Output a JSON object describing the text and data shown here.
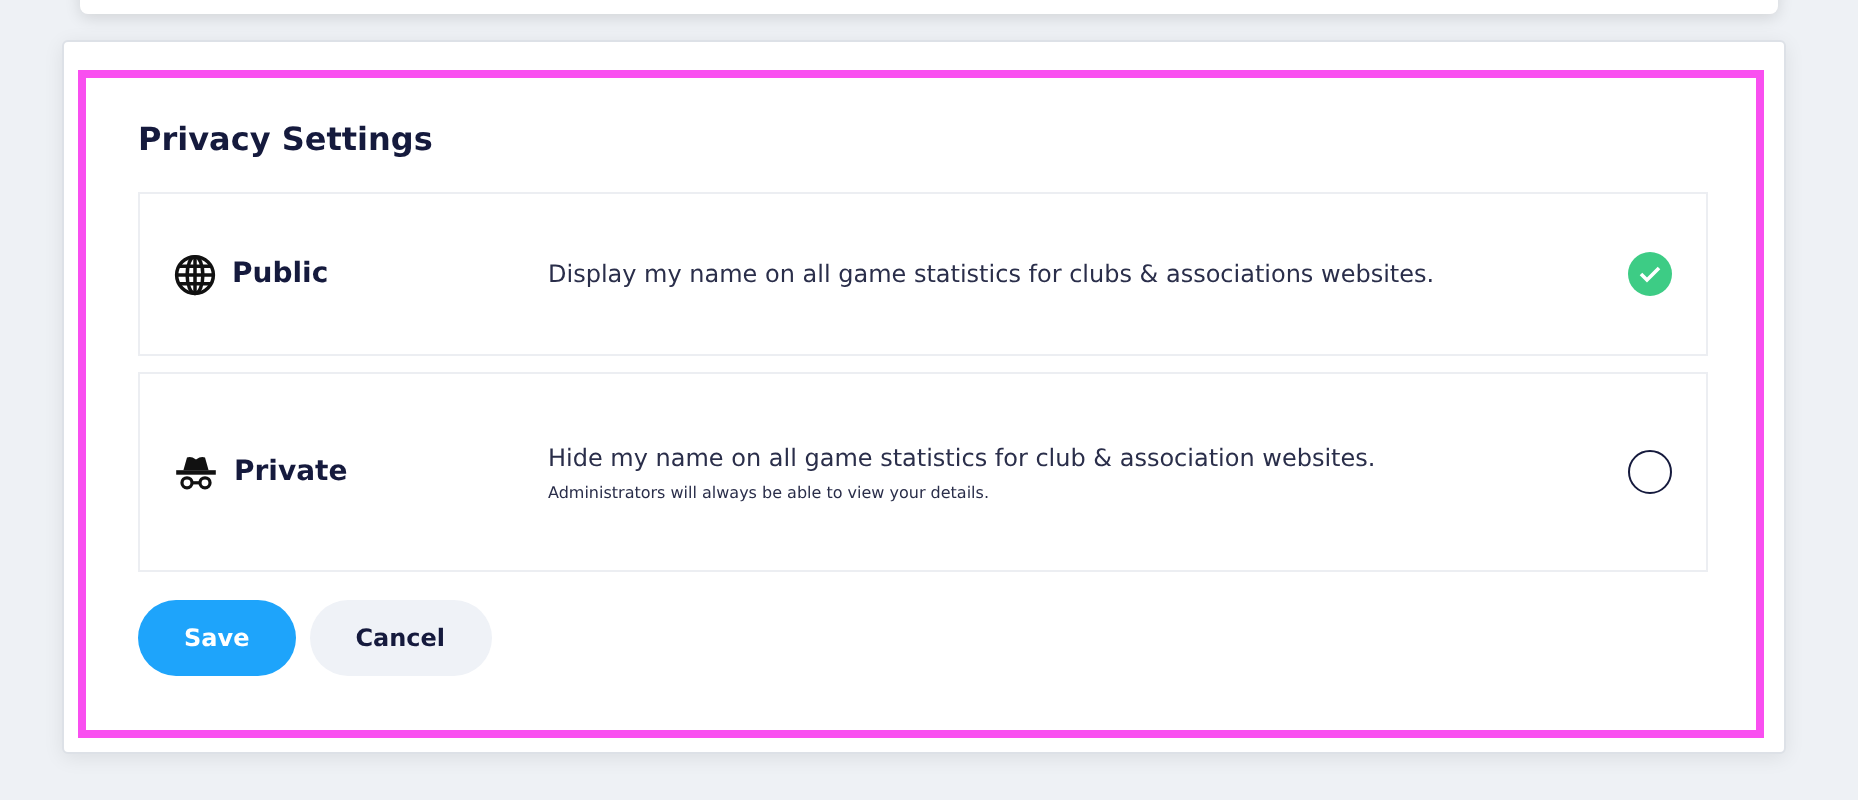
{
  "title": "Privacy Settings",
  "options": [
    {
      "kind": "globe",
      "label": "Public",
      "description": "Display my name on all game statistics for clubs & associations websites.",
      "selected": true
    },
    {
      "kind": "incognito",
      "label": "Private",
      "description": "Hide my name on all game statistics for club & association websites.",
      "note": "Administrators will always be able to view your details.",
      "selected": false
    }
  ],
  "buttons": [
    {
      "label": "Save",
      "kind": "primary"
    },
    {
      "label": "Cancel",
      "kind": "secondary"
    }
  ]
}
